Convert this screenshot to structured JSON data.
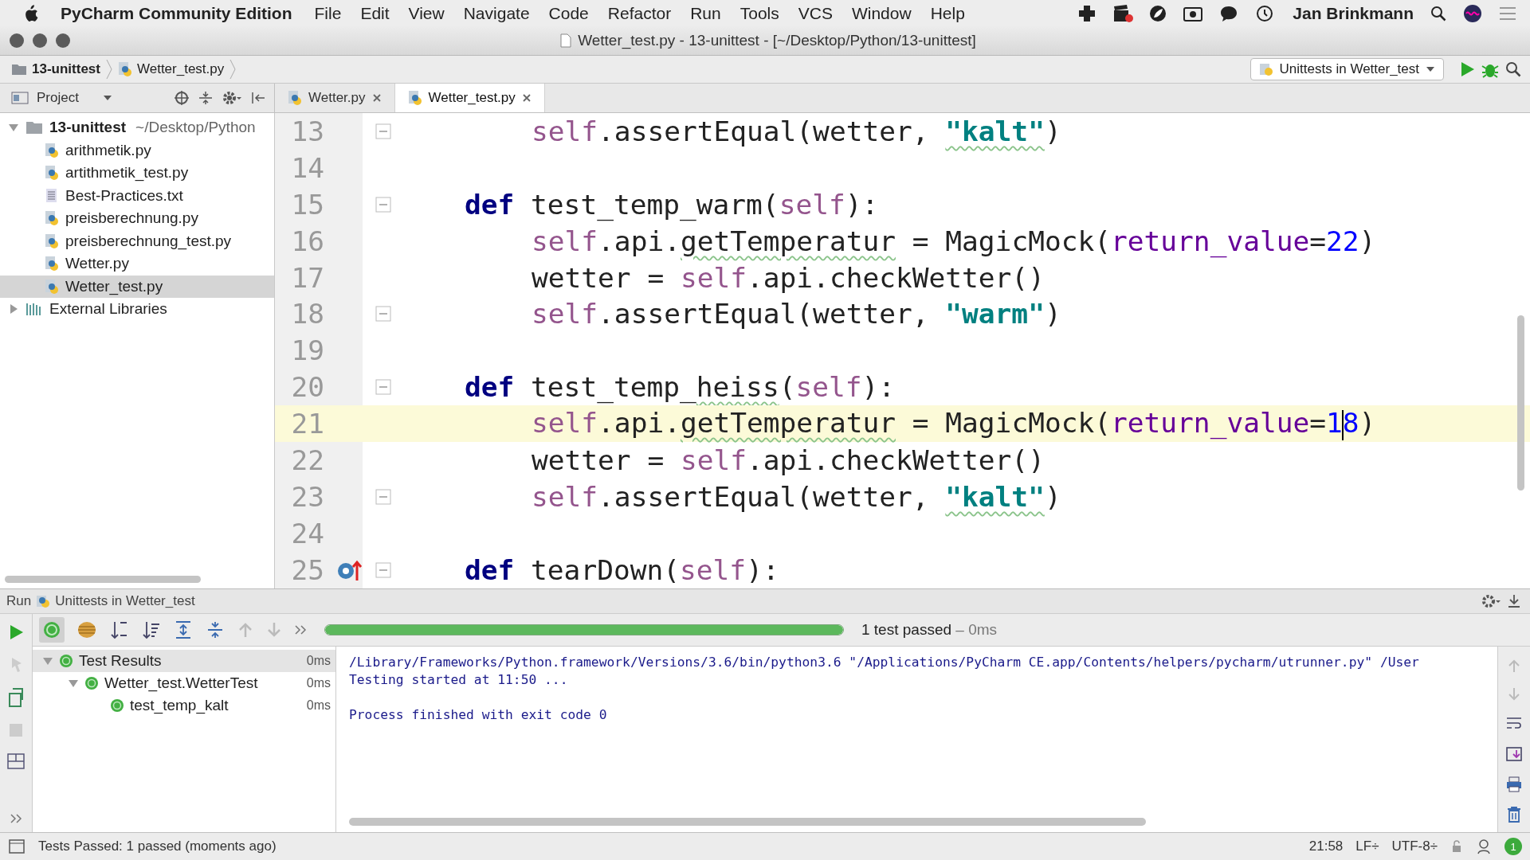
{
  "menu_bar": {
    "app_name": "PyCharm Community Edition",
    "items": [
      "File",
      "Edit",
      "View",
      "Navigate",
      "Code",
      "Refactor",
      "Run",
      "Tools",
      "VCS",
      "Window",
      "Help"
    ],
    "user": "Jan Brinkmann"
  },
  "window": {
    "title": "Wetter_test.py - 13-unittest - [~/Desktop/Python/13-unittest]"
  },
  "breadcrumbs": [
    "13-unittest",
    "Wetter_test.py"
  ],
  "run_config": {
    "label": "Unittests in Wetter_test"
  },
  "project_panel": {
    "title": "Project",
    "tree": [
      {
        "name": "13-unittest",
        "path": "~/Desktop/Python",
        "kind": "folder",
        "expanded": true,
        "selected": false,
        "children": [
          {
            "name": "arithmetik.py",
            "kind": "python",
            "selected": false
          },
          {
            "name": "artithmetik_test.py",
            "kind": "python",
            "selected": false
          },
          {
            "name": "Best-Practices.txt",
            "kind": "text",
            "selected": false
          },
          {
            "name": "preisberechnung.py",
            "kind": "python",
            "selected": false
          },
          {
            "name": "preisberechnung_test.py",
            "kind": "python",
            "selected": false
          },
          {
            "name": "Wetter.py",
            "kind": "python",
            "selected": false
          },
          {
            "name": "Wetter_test.py",
            "kind": "python",
            "selected": true
          }
        ]
      },
      {
        "name": "External Libraries",
        "kind": "library",
        "expanded": false,
        "selected": false
      }
    ]
  },
  "tabs": [
    {
      "label": "Wetter.py",
      "selected": false
    },
    {
      "label": "Wetter_test.py",
      "selected": true
    }
  ],
  "editor": {
    "lines": [
      {
        "number": "13",
        "fold": true,
        "override": false,
        "current": false,
        "kind": "body",
        "tokens": [
          {
            "kind": "self",
            "text": "self"
          },
          {
            "kind": "plain",
            "text": ".assertEqual(wetter, "
          },
          {
            "kind": "str",
            "text": "\"kalt\"",
            "spell": true
          },
          {
            "kind": "plain",
            "text": ")"
          }
        ]
      },
      {
        "number": "14",
        "fold": false,
        "override": false,
        "current": false,
        "kind": "blank"
      },
      {
        "number": "15",
        "fold": true,
        "override": false,
        "current": false,
        "kind": "def",
        "tokens": [
          {
            "kind": "kw",
            "text": "def"
          },
          {
            "kind": "plain",
            "text": " test_temp_warm("
          },
          {
            "kind": "self",
            "text": "self"
          },
          {
            "kind": "plain",
            "text": "):"
          }
        ]
      },
      {
        "number": "16",
        "fold": false,
        "override": false,
        "current": false,
        "kind": "body",
        "tokens": [
          {
            "kind": "self",
            "text": "self"
          },
          {
            "kind": "plain",
            "text": ".api."
          },
          {
            "kind": "plain",
            "text": "getTemperatur",
            "spell": true
          },
          {
            "kind": "plain",
            "text": " = MagicMock("
          },
          {
            "kind": "param",
            "text": "return_value"
          },
          {
            "kind": "plain",
            "text": "="
          },
          {
            "kind": "num",
            "text": "22"
          },
          {
            "kind": "plain",
            "text": ")"
          }
        ]
      },
      {
        "number": "17",
        "fold": false,
        "override": false,
        "current": false,
        "kind": "body",
        "tokens": [
          {
            "kind": "plain",
            "text": "wetter = "
          },
          {
            "kind": "self",
            "text": "self"
          },
          {
            "kind": "plain",
            "text": ".api.checkWetter()"
          }
        ]
      },
      {
        "number": "18",
        "fold": true,
        "override": false,
        "current": false,
        "kind": "body",
        "tokens": [
          {
            "kind": "self",
            "text": "self"
          },
          {
            "kind": "plain",
            "text": ".assertEqual(wetter, "
          },
          {
            "kind": "str",
            "text": "\"warm\""
          },
          {
            "kind": "plain",
            "text": ")"
          }
        ]
      },
      {
        "number": "19",
        "fold": false,
        "override": false,
        "current": false,
        "kind": "blank"
      },
      {
        "number": "20",
        "fold": true,
        "override": false,
        "current": false,
        "kind": "def",
        "tokens": [
          {
            "kind": "kw",
            "text": "def"
          },
          {
            "kind": "plain",
            "text": " test_temp_"
          },
          {
            "kind": "plain",
            "text": "heiss",
            "spell": true
          },
          {
            "kind": "plain",
            "text": "("
          },
          {
            "kind": "self",
            "text": "self"
          },
          {
            "kind": "plain",
            "text": "):"
          }
        ]
      },
      {
        "number": "21",
        "fold": false,
        "override": false,
        "current": true,
        "kind": "body",
        "tokens": [
          {
            "kind": "self",
            "text": "self"
          },
          {
            "kind": "plain",
            "text": ".api."
          },
          {
            "kind": "plain",
            "text": "getTemperatur",
            "spell": true
          },
          {
            "kind": "plain",
            "text": " = MagicMock("
          },
          {
            "kind": "param",
            "text": "return_value"
          },
          {
            "kind": "plain",
            "text": "="
          },
          {
            "kind": "num",
            "text": "1"
          },
          {
            "kind": "caret"
          },
          {
            "kind": "num",
            "text": "8"
          },
          {
            "kind": "plain",
            "text": ")"
          }
        ]
      },
      {
        "number": "22",
        "fold": false,
        "override": false,
        "current": false,
        "kind": "body",
        "tokens": [
          {
            "kind": "plain",
            "text": "wetter = "
          },
          {
            "kind": "self",
            "text": "self"
          },
          {
            "kind": "plain",
            "text": ".api.checkWetter()"
          }
        ]
      },
      {
        "number": "23",
        "fold": true,
        "override": false,
        "current": false,
        "kind": "body",
        "tokens": [
          {
            "kind": "self",
            "text": "self"
          },
          {
            "kind": "plain",
            "text": ".assertEqual(wetter, "
          },
          {
            "kind": "str",
            "text": "\"kalt\"",
            "spell": true
          },
          {
            "kind": "plain",
            "text": ")"
          }
        ]
      },
      {
        "number": "24",
        "fold": false,
        "override": false,
        "current": false,
        "kind": "blank"
      },
      {
        "number": "25",
        "fold": true,
        "override": true,
        "current": false,
        "kind": "def",
        "tokens": [
          {
            "kind": "kw",
            "text": "def"
          },
          {
            "kind": "plain",
            "text": " tearDown("
          },
          {
            "kind": "self",
            "text": "self"
          },
          {
            "kind": "plain",
            "text": "):"
          }
        ]
      }
    ]
  },
  "run_panel": {
    "label": "Run",
    "config": "Unittests in Wetter_test",
    "progress": {
      "level": 1.0,
      "text": "1 test passed",
      "time": "– 0ms"
    },
    "tests": [
      {
        "name": "Test Results",
        "time": "0ms",
        "expanded": true,
        "selected": true,
        "children": [
          {
            "name": "Wetter_test.WetterTest",
            "time": "0ms",
            "expanded": true,
            "selected": false,
            "children": [
              {
                "name": "test_temp_kalt",
                "time": "0ms",
                "selected": false
              }
            ]
          }
        ]
      }
    ],
    "console": [
      {
        "kind": "command",
        "text": "/Library/Frameworks/Python.framework/Versions/3.6/bin/python3.6 \"/Applications/PyCharm CE.app/Contents/helpers/pycharm/utrunner.py\" /User"
      },
      {
        "kind": "output",
        "text": "Testing started at 11:50 ..."
      },
      {
        "kind": "exit",
        "text": "Process finished with exit code 0"
      }
    ]
  },
  "status_bar": {
    "message": "Tests Passed: 1 passed (moments ago)",
    "position": "21:58",
    "line_sep": "LF÷",
    "encoding": "UTF-8÷",
    "notifications": "1"
  }
}
